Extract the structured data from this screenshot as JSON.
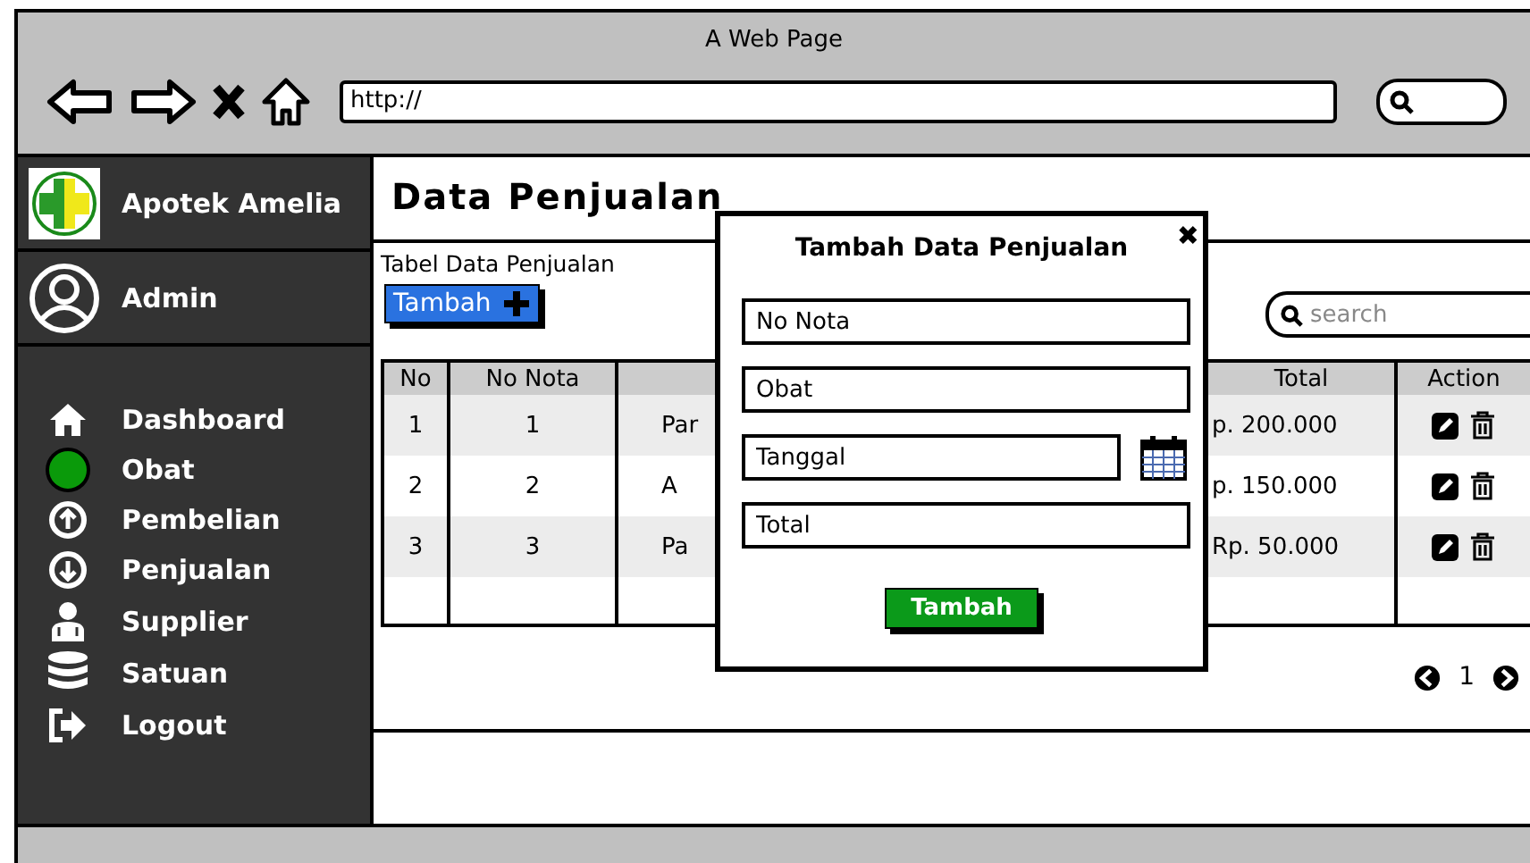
{
  "window": {
    "title": "A Web Page"
  },
  "browser": {
    "url": "http://"
  },
  "sidebar": {
    "brand": "Apotek Amelia",
    "user": "Admin",
    "items": [
      {
        "label": "Dashboard"
      },
      {
        "label": "Obat"
      },
      {
        "label": "Pembelian"
      },
      {
        "label": "Penjualan"
      },
      {
        "label": "Supplier"
      },
      {
        "label": "Satuan"
      },
      {
        "label": "Logout"
      }
    ]
  },
  "page": {
    "title": "Data Penjualan",
    "table_title": "Tabel Data Penjualan",
    "add_button": "Tambah",
    "search": {
      "placeholder": "search"
    }
  },
  "table": {
    "columns": [
      "No",
      "No Nota",
      "Total",
      "Action"
    ],
    "rows": [
      {
        "no": "1",
        "no_nota": "1",
        "column_3": "Par",
        "total": "p. 200.000"
      },
      {
        "no": "2",
        "no_nota": "2",
        "column_3": "A",
        "total": "p. 150.000"
      },
      {
        "no": "3",
        "no_nota": "3",
        "column_3": "Pa",
        "total": "Rp. 50.000"
      }
    ]
  },
  "pagination": {
    "page": "1"
  },
  "dialog": {
    "title": "Tambah Data Penjualan",
    "close": "✖",
    "fields": [
      {
        "placeholder": "No Nota",
        "kind": "text"
      },
      {
        "placeholder": "Obat",
        "kind": "text"
      },
      {
        "placeholder": "Tanggal",
        "kind": "date"
      },
      {
        "placeholder": "Total",
        "kind": "text"
      }
    ],
    "submit": "Tambah"
  }
}
